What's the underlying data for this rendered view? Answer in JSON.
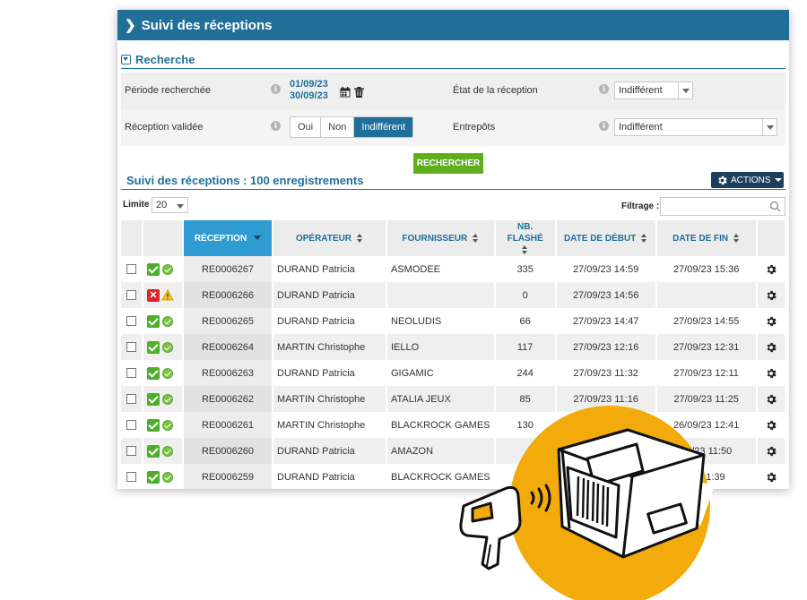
{
  "header": {
    "title": "Suivi des réceptions"
  },
  "search": {
    "title": "Recherche",
    "periode_label": "Période recherchée",
    "date_from": "01/09/23",
    "date_to": "30/09/23",
    "validee_label": "Réception validée",
    "validee_options": [
      "Oui",
      "Non",
      "Indifférent"
    ],
    "validee_selected": "Indifférent",
    "etat_label": "État de la réception",
    "etat_value": "Indifférent",
    "entrepots_label": "Entrepôts",
    "entrepots_value": "Indifférent",
    "search_button": "RECHERCHER"
  },
  "results": {
    "title": "Suivi des réceptions : 100 enregistrements",
    "actions_button": "ACTIONS",
    "limit_label": "Limite",
    "limit_value": "20",
    "filter_label": "Filtrage :"
  },
  "table": {
    "columns": [
      "RÉCEPTION",
      "OPÉRATEUR",
      "FOURNISSEUR",
      "NB. FLASHÉ",
      "DATE DE DÉBUT",
      "DATE DE FIN"
    ],
    "rows": [
      {
        "status": "ok",
        "ref": "RE0006267",
        "operateur": "DURAND Patricia",
        "fournisseur": "ASMODEE",
        "nb": "335",
        "debut": "27/09/23 14:59",
        "fin": "27/09/23 15:36"
      },
      {
        "status": "error",
        "ref": "RE0006266",
        "operateur": "DURAND Patricia",
        "fournisseur": "",
        "nb": "0",
        "debut": "27/09/23 14:56",
        "fin": ""
      },
      {
        "status": "ok",
        "ref": "RE0006265",
        "operateur": "DURAND Patricia",
        "fournisseur": "NEOLUDIS",
        "nb": "66",
        "debut": "27/09/23 14:47",
        "fin": "27/09/23 14:55"
      },
      {
        "status": "ok",
        "ref": "RE0006264",
        "operateur": "MARTIN Christophe",
        "fournisseur": "IELLO",
        "nb": "117",
        "debut": "27/09/23 12:16",
        "fin": "27/09/23 12:31"
      },
      {
        "status": "ok",
        "ref": "RE0006263",
        "operateur": "DURAND Patricia",
        "fournisseur": "GIGAMIC",
        "nb": "244",
        "debut": "27/09/23 11:32",
        "fin": "27/09/23 12:11"
      },
      {
        "status": "ok",
        "ref": "RE0006262",
        "operateur": "MARTIN Christophe",
        "fournisseur": "ATALIA JEUX",
        "nb": "85",
        "debut": "27/09/23 11:16",
        "fin": "27/09/23 11:25"
      },
      {
        "status": "ok",
        "ref": "RE0006261",
        "operateur": "MARTIN Christophe",
        "fournisseur": "BLACKROCK GAMES",
        "nb": "130",
        "debut": "",
        "fin": "26/09/23 12:41"
      },
      {
        "status": "ok",
        "ref": "RE0006260",
        "operateur": "DURAND Patricia",
        "fournisseur": "AMAZON",
        "nb": "",
        "debut": "",
        "fin": "09/23 11:50"
      },
      {
        "status": "ok",
        "ref": "RE0006259",
        "operateur": "DURAND Patricia",
        "fournisseur": "BLACKROCK GAMES",
        "nb": "",
        "debut": "",
        "fin": "23 11:39"
      }
    ]
  },
  "colors": {
    "primary": "#1f6f99",
    "sorted_header": "#2f9bd3",
    "search_button": "#5fae1e",
    "actions_button": "#1c3f5c",
    "illustration": "#f2ab0a"
  }
}
